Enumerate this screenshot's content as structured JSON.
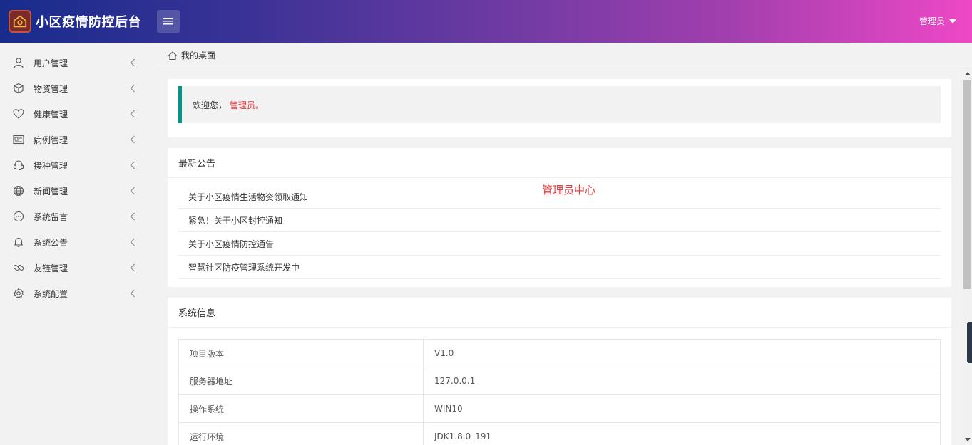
{
  "header": {
    "app_title": "小区疫情防控后台",
    "user_label": "管理员"
  },
  "sidebar": {
    "items": [
      {
        "label": "用户管理",
        "icon": "user-icon"
      },
      {
        "label": "物资管理",
        "icon": "cube-icon"
      },
      {
        "label": "健康管理",
        "icon": "heart-icon"
      },
      {
        "label": "病例管理",
        "icon": "id-card-icon"
      },
      {
        "label": "接种管理",
        "icon": "support-icon"
      },
      {
        "label": "新闻管理",
        "icon": "globe-icon"
      },
      {
        "label": "系统留言",
        "icon": "message-icon"
      },
      {
        "label": "系统公告",
        "icon": "bell-icon"
      },
      {
        "label": "友链管理",
        "icon": "link-icon"
      },
      {
        "label": "系统配置",
        "icon": "gear-icon"
      }
    ]
  },
  "breadcrumb": {
    "label": "我的桌面"
  },
  "welcome": {
    "greeting": "欢迎您，",
    "name": "管理员。"
  },
  "notice": {
    "title": "最新公告",
    "center_label": "管理员中心",
    "items": [
      "关于小区疫情生活物资领取通知",
      "紧急！关于小区封控通知",
      "关于小区疫情防控通告",
      "智慧社区防疫管理系统开发中"
    ]
  },
  "system_info": {
    "title": "系统信息",
    "rows": [
      {
        "key": "项目版本",
        "value": "V1.0"
      },
      {
        "key": "服务器地址",
        "value": "127.0.0.1"
      },
      {
        "key": "操作系统",
        "value": "WIN10"
      },
      {
        "key": "运行环境",
        "value": "JDK1.8.0_191"
      }
    ]
  },
  "colors": {
    "accent": "#009688",
    "highlight": "#e4393c"
  }
}
